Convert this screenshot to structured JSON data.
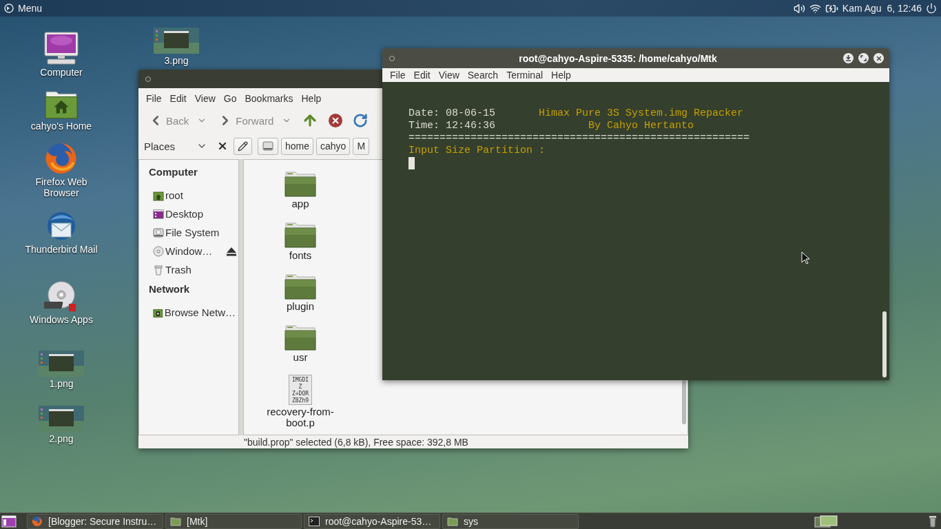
{
  "top_panel": {
    "menu_label": "Menu",
    "clock": "Kam Agu  6, 12:46"
  },
  "desktop_icons": [
    {
      "label": "3.png",
      "kind": "thumbnail"
    },
    {
      "label": "Computer",
      "kind": "computer"
    },
    {
      "label": "cahyo's Home",
      "kind": "home"
    },
    {
      "label": "Firefox Web Browser",
      "kind": "firefox"
    },
    {
      "label": "Thunderbird Mail",
      "kind": "thunderbird"
    },
    {
      "label": "Windows Apps",
      "kind": "dvd"
    },
    {
      "label": "1.png",
      "kind": "thumbnail"
    },
    {
      "label": "2.png",
      "kind": "thumbnail"
    }
  ],
  "file_manager": {
    "menu": [
      "File",
      "Edit",
      "View",
      "Go",
      "Bookmarks",
      "Help"
    ],
    "nav_buttons": [
      {
        "label": "Back",
        "kind": "back",
        "disabled": true
      },
      {
        "label": "Forward",
        "kind": "forward",
        "disabled": true
      }
    ],
    "tool_icons": [
      {
        "kind": "up"
      },
      {
        "kind": "stop"
      },
      {
        "kind": "reload"
      }
    ],
    "places_label": "Places",
    "path_buttons": [
      "home",
      "cahyo",
      "M"
    ],
    "sidebar": [
      {
        "heading": "Computer",
        "items": [
          {
            "label": "root",
            "kind": "home",
            "ejectable": false
          },
          {
            "label": "Desktop",
            "kind": "desktop",
            "ejectable": false
          },
          {
            "label": "File System",
            "kind": "drive",
            "ejectable": false
          },
          {
            "label": "Window…",
            "kind": "disc",
            "ejectable": true
          },
          {
            "label": "Trash",
            "kind": "trash",
            "ejectable": false
          }
        ]
      },
      {
        "heading": "Network",
        "items": [
          {
            "label": "Browse Netw…",
            "kind": "network",
            "ejectable": false
          }
        ]
      }
    ],
    "files": [
      {
        "name": "app",
        "kind": "folder"
      },
      {
        "name": "fonts",
        "kind": "folder"
      },
      {
        "name": "plugin",
        "kind": "folder"
      },
      {
        "name": "usr",
        "kind": "folder"
      },
      {
        "name": "recovery-from-boot.p",
        "kind": "document",
        "preview": [
          "IMGDI",
          "Z",
          "Z÷DOR",
          "ZBZh9"
        ]
      }
    ],
    "status": "\"build.prop\" selected (6,8 kB), Free space: 392,8 MB"
  },
  "terminal": {
    "title": "root@cahyo-Aspire-5335: /home/cahyo/Mtk",
    "menu": [
      "File",
      "Edit",
      "View",
      "Search",
      "Terminal",
      "Help"
    ],
    "date": "Date: 08-06-15",
    "time": "Time: 12:46:36",
    "heading": "Himax Pure 3S System.img Repacker",
    "byline": "By Cahyo Hertanto",
    "rule": "=======================================================",
    "prompt": "Input Size Partition :"
  },
  "taskbar": {
    "items": [
      {
        "label": "[Blogger: Secure Instru…",
        "kind": "firefox"
      },
      {
        "label": "[Mtk]",
        "kind": "folder"
      },
      {
        "label": "root@cahyo-Aspire-53…",
        "kind": "terminal"
      },
      {
        "label": "sys",
        "kind": "folder"
      }
    ]
  }
}
